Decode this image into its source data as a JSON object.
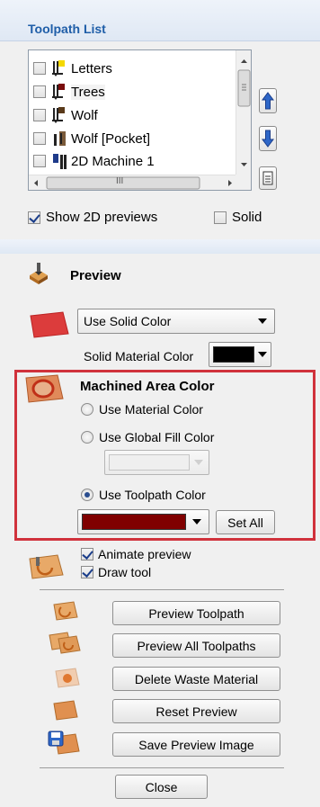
{
  "toolpath_list": {
    "title": "Toolpath List",
    "items": [
      {
        "label": "Letters",
        "checked": false
      },
      {
        "label": "Trees",
        "checked": false
      },
      {
        "label": "Wolf",
        "checked": false
      },
      {
        "label": "Wolf [Pocket]",
        "checked": false
      },
      {
        "label": "2D Machine 1",
        "checked": false
      }
    ],
    "hscroll_grip": "III",
    "show_2d_previews_label": "Show 2D previews",
    "show_2d_previews_checked": true,
    "solid_label": "Solid",
    "solid_checked": false
  },
  "preview": {
    "title": "Preview",
    "color_mode_select": "Use Solid Color",
    "solid_material_color_label": "Solid Material Color",
    "solid_material_color": "#000000",
    "machined_area": {
      "title": "Machined Area Color",
      "option_material": "Use Material Color",
      "option_global_fill": "Use Global Fill Color",
      "option_toolpath": "Use Toolpath Color",
      "selected": "toolpath",
      "toolpath_color": "#800000",
      "set_all_label": "Set All"
    },
    "animate_preview_label": "Animate preview",
    "animate_preview_checked": true,
    "draw_tool_label": "Draw tool",
    "draw_tool_checked": true,
    "buttons": {
      "preview_toolpath": "Preview Toolpath",
      "preview_all": "Preview All Toolpaths",
      "delete_waste": "Delete Waste Material",
      "reset_preview": "Reset Preview",
      "save_image": "Save Preview Image"
    },
    "close_label": "Close"
  },
  "colors": {
    "highlight_border": "#d0323c",
    "header_text": "#1f5ea8",
    "arrow_blue": "#2e67c8"
  }
}
